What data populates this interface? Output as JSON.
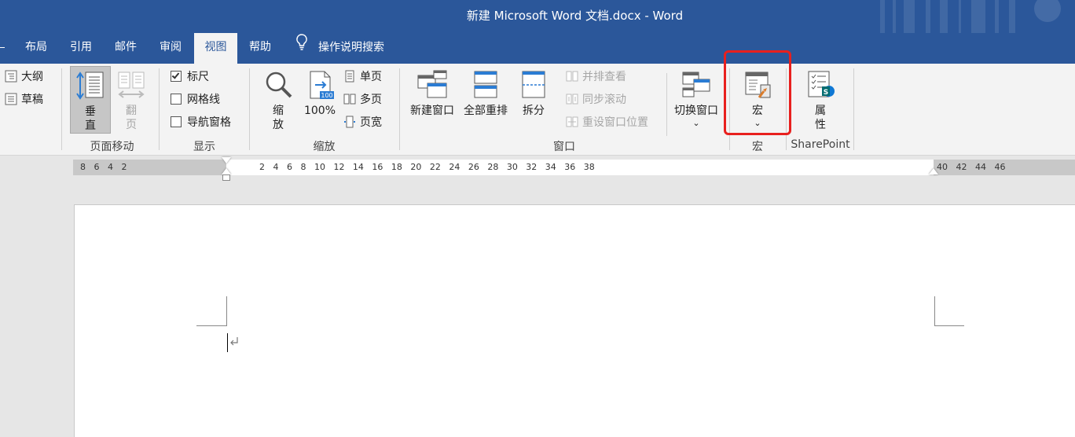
{
  "window": {
    "title": "新建 Microsoft Word 文档.docx  -  Word"
  },
  "tabs": [
    {
      "label": "布局"
    },
    {
      "label": "引用"
    },
    {
      "label": "邮件"
    },
    {
      "label": "审阅"
    },
    {
      "label": "视图",
      "active": true
    },
    {
      "label": "帮助"
    }
  ],
  "tell_me": {
    "label": "操作说明搜索",
    "icon": "lightbulb-icon"
  },
  "ribbon": {
    "views": {
      "outline": "大纲",
      "draft": "草稿"
    },
    "page_movement": {
      "label": "页面移动",
      "vertical": "垂\n直",
      "side_to_side": "翻\n页"
    },
    "show": {
      "label": "显示",
      "ruler": "标尺",
      "ruler_checked": true,
      "gridlines": "网格线",
      "gridlines_checked": false,
      "nav_pane": "导航窗格",
      "nav_pane_checked": false
    },
    "zoom": {
      "label": "缩放",
      "zoom": "缩\n放",
      "hundred": "100%",
      "one_page": "单页",
      "multi_page": "多页",
      "page_width": "页宽"
    },
    "window": {
      "label": "窗口",
      "new_window": "新建窗口",
      "arrange_all": "全部重排",
      "split": "拆分",
      "side_by_side": "并排查看",
      "sync_scroll": "同步滚动",
      "reset_position": "重设窗口位置",
      "switch_windows": "切换窗口",
      "chevron": "⌄"
    },
    "macros": {
      "label": "宏",
      "macros": "宏",
      "chevron": "⌄"
    },
    "sharepoint": {
      "label": "SharePoint",
      "properties": "属\n性"
    }
  },
  "ruler": {
    "left_numbers": "8   6   4   2",
    "right_numbers": "2   4   6   8   10   12   14   16   18   20   22   24   26   28   30   32   34   36   38",
    "margin_numbers": "40   42   44   46"
  },
  "colors": {
    "title_bar": "#2b579a",
    "ribbon": "#f3f3f3",
    "highlight": "#e8201e"
  }
}
